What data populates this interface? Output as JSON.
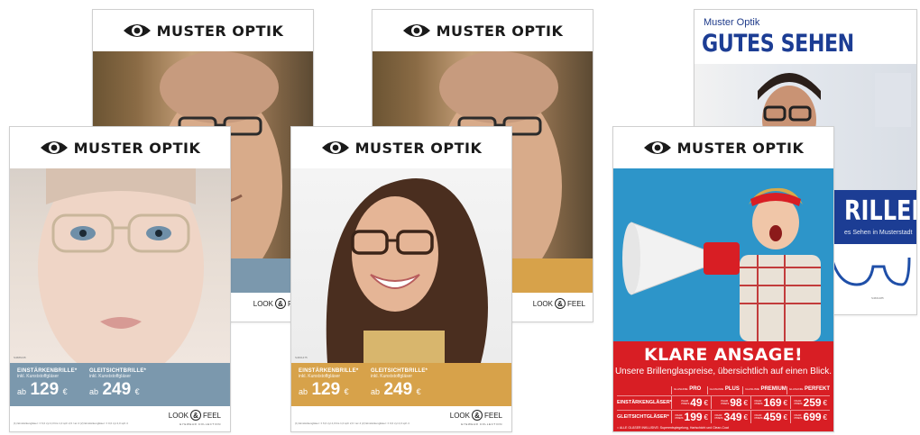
{
  "brand": {
    "name": "MUSTER OPTIK",
    "logo_icon": "eye-icon"
  },
  "colors": {
    "blue_band": "#7b98ad",
    "orange_band": "#d7a24a",
    "red": "#d81e24",
    "dark": "#1a1a1a"
  },
  "posters": {
    "blue": {
      "image_code": "S4686135",
      "offer1": {
        "label": "EINSTÄRKENBRILLE*",
        "sub": "inkl. Kunststoffgläser",
        "prefix": "ab",
        "price": "129",
        "currency": "€"
      },
      "offer2": {
        "label": "GLEITSICHTBRILLE*",
        "sub": "inkl. Kunststoffgläser",
        "prefix": "ab",
        "price": "249",
        "currency": "€"
      },
      "footnote": "(1) Einstärkengläser: ± 6,0 cyl 4,0 bis 1,0 sph 2,0 / ac 4    (2) Einstärkengläser: ± 0,0 cyl 4,0 sph 4"
    },
    "orange": {
      "image_code": "S4661475",
      "offer1": {
        "label": "EINSTÄRKENBRILLE*",
        "sub": "inkl. Kunststoffgläser",
        "prefix": "ab",
        "price": "129",
        "currency": "€"
      },
      "offer2": {
        "label": "GLEITSICHTBRILLE*",
        "sub": "inkl. Kunststoffgläser",
        "prefix": "ab",
        "price": "249",
        "currency": "€"
      },
      "footnote": "(1) Einstärkengläser: ± 6,0 cyl 4,0 bis 1,0 sph 2,0 / ac 4    (2) Einstärkengläser: ± 0,0 cyl 4,0 sph 4"
    },
    "lookfeel": {
      "look": "LOOK",
      "amp": "&",
      "feel": "FEEL",
      "tagline": "EYEWEAR COLLECTION"
    },
    "brochure": {
      "kicker": "Muster Optik",
      "title": "GUTES SEHEN",
      "big_word": "RILLEN",
      "tagline": "es Sehen in Musterstadt",
      "code": "S4661485"
    },
    "red": {
      "headline": "KLARE ANSAGE!",
      "subline": "Unsere Brillenglaspreise, übersichtlich auf einen Blick.",
      "tiers": [
        "PRO",
        "PLUS",
        "PREMIUM",
        "PERFEKT"
      ],
      "tier_prefix": [
        "GLASLINIE",
        "GLASLINIE",
        "GLASLINIE",
        "GLASLINIE"
      ],
      "rows": [
        {
          "label": "EINSTÄRKENGLÄSER*",
          "prices": [
            "49",
            "98",
            "169",
            "259"
          ]
        },
        {
          "label": "GLEITSICHTGLÄSER*",
          "prices": [
            "199",
            "349",
            "459",
            "699"
          ]
        }
      ],
      "paar": "PAAR PREIS",
      "currency": "€",
      "footnote": "= ALLE GLÄSER INKLUSIVE: Superentspiegelung, Hartschicht und Clean-Coat"
    }
  }
}
